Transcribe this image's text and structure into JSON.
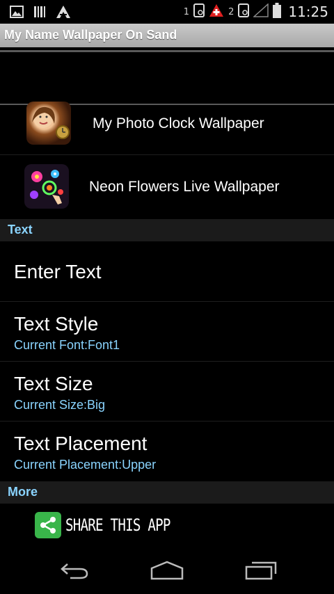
{
  "status_bar": {
    "sim1_label": "1",
    "sim2_label": "2",
    "time": "11:25",
    "icons": [
      "picture-icon",
      "barcode-icon",
      "arrow-logo-icon",
      "phone-sim1-icon",
      "first-aid-icon",
      "phone-sim2-icon",
      "signal-icon",
      "battery-icon"
    ]
  },
  "app": {
    "title": "My Name Wallpaper On Sand"
  },
  "promo_apps": [
    {
      "label": "My Photo Clock Wallpaper",
      "icon": "photo-clock-app-icon"
    },
    {
      "label": "Neon Flowers Live Wallpaper",
      "icon": "neon-flowers-app-icon"
    }
  ],
  "sections": {
    "text_header": "Text",
    "more_header": "More"
  },
  "prefs": {
    "enter_text": {
      "title": "Enter Text"
    },
    "text_style": {
      "title": "Text Style",
      "summary": "Current Font:Font1"
    },
    "text_size": {
      "title": "Text Size",
      "summary": "Current Size:Big"
    },
    "text_placement": {
      "title": "Text Placement",
      "summary": "Current Placement:Upper"
    }
  },
  "share": {
    "label": "SHARE THIS APP",
    "color": "#39b54a"
  },
  "navigation": {
    "buttons": [
      "back-icon",
      "home-icon",
      "recent-apps-icon"
    ]
  },
  "colors": {
    "accent": "#8ad4ff",
    "background": "#000000",
    "section_bg": "#1b1b1b"
  }
}
